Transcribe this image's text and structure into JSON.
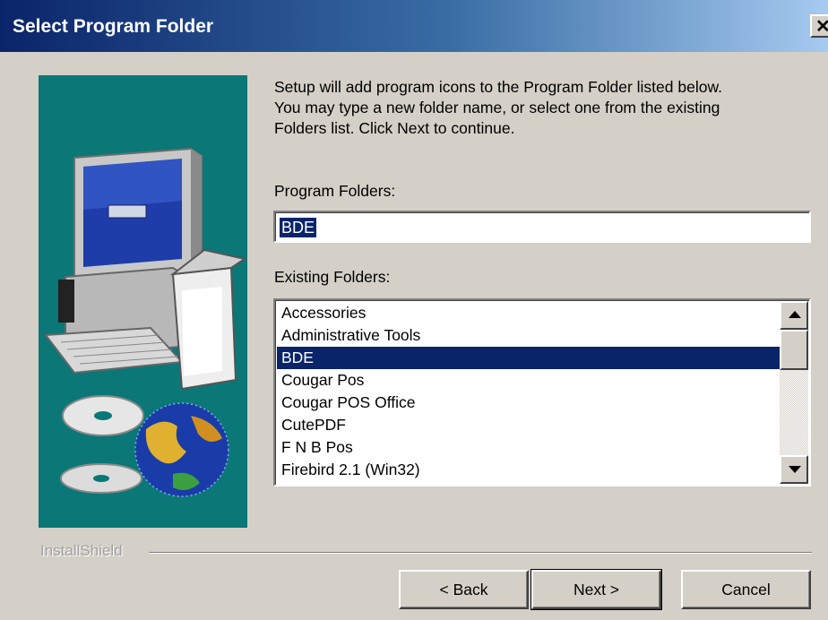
{
  "window": {
    "title": "Select Program Folder",
    "close_glyph": "✕"
  },
  "description": "Setup will add program icons to the Program Folder listed below.\nYou may type a new folder name, or select one from the existing\nFolders list.  Click Next to continue.",
  "program_folders": {
    "label": "Program Folders:",
    "value": "BDE"
  },
  "existing_folders": {
    "label": "Existing Folders:",
    "items": [
      "Accessories",
      "Administrative Tools",
      "BDE",
      "Cougar Pos",
      "Cougar POS Office",
      "CutePDF",
      "F N B Pos",
      "Firebird 2.1 (Win32)"
    ],
    "selected_index": 2
  },
  "footer": {
    "brand": "InstallShield",
    "back_label": "< Back",
    "next_label": "Next >",
    "cancel_label": "Cancel"
  },
  "colors": {
    "art_background": "#0b7777",
    "selection": "#0a246a"
  },
  "icons": [
    "close-icon",
    "computer-illustration",
    "cd-disc-icon",
    "globe-icon",
    "scroll-up-icon",
    "scroll-down-icon"
  ]
}
